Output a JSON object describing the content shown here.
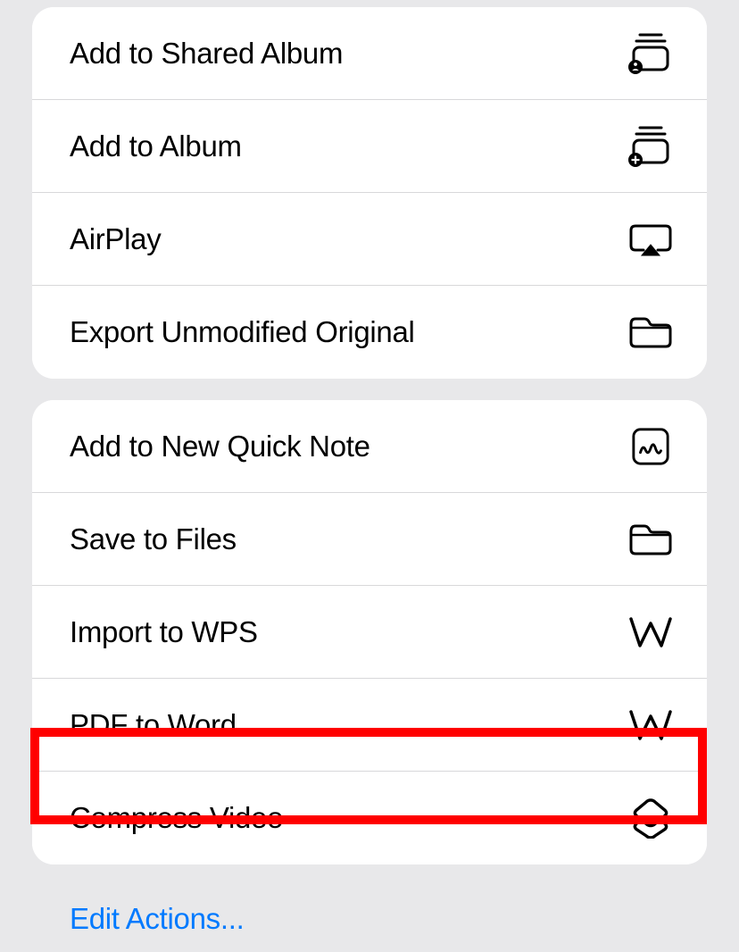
{
  "groups": [
    {
      "items": [
        {
          "label": "Add to Shared Album",
          "icon": "shared-album-icon",
          "name": "add-to-shared-album"
        },
        {
          "label": "Add to Album",
          "icon": "add-album-icon",
          "name": "add-to-album"
        },
        {
          "label": "AirPlay",
          "icon": "airplay-icon",
          "name": "airplay"
        },
        {
          "label": "Export Unmodified Original",
          "icon": "folder-icon",
          "name": "export-unmodified-original"
        }
      ]
    },
    {
      "items": [
        {
          "label": "Add to New Quick Note",
          "icon": "quick-note-icon",
          "name": "add-to-new-quick-note"
        },
        {
          "label": "Save to Files",
          "icon": "folder-icon",
          "name": "save-to-files"
        },
        {
          "label": "Import to WPS",
          "icon": "wps-icon",
          "name": "import-to-wps"
        },
        {
          "label": "PDF to Word",
          "icon": "wps-icon",
          "name": "pdf-to-word"
        },
        {
          "label": "Compress Video",
          "icon": "shortcuts-icon",
          "name": "compress-video",
          "highlighted": true
        }
      ]
    }
  ],
  "editActions": {
    "label": "Edit Actions..."
  }
}
